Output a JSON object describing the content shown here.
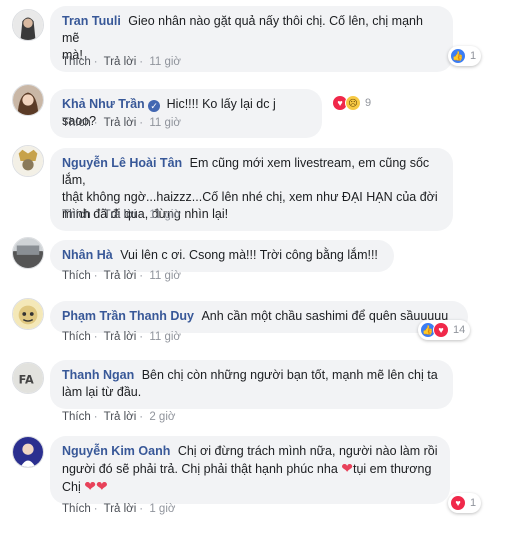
{
  "actions": {
    "like": "Thích",
    "reply": "Trả lời"
  },
  "comments": [
    {
      "author": "Tran Tuuli",
      "text_lines": [
        "Gieo nhân nào gặt quả nấy thôi chị. Cố lên, chị mạnh mẽ",
        "mà!"
      ],
      "time": "11 giờ",
      "reaction_count": "1",
      "reaction_types": [
        "like"
      ]
    },
    {
      "author": "Khả Như Trần",
      "verified": true,
      "text_lines": [
        "Hic!!!! Ko lấy lại dc j saoo?"
      ],
      "time": "11 giờ",
      "reaction_count": "9",
      "reaction_types": [
        "love",
        "sad"
      ]
    },
    {
      "author": "Nguyễn Lê Hoài Tân",
      "text_lines": [
        "Em cũng mới xem livestream, em cũng sốc lắm,",
        "thật không ngờ...haizzz...Cố lên nhé chị, xem như ĐẠI HẠN của đời",
        "mình đã đi qua, đừng nhìn lại!"
      ],
      "time": "11 giờ"
    },
    {
      "author": "Nhân Hà",
      "text_lines": [
        "Vui lên c ơi. Csong mà!!! Trời công bằng lắm!!!"
      ],
      "time": "11 giờ"
    },
    {
      "author": "Phạm Trần Thanh Duy",
      "text_lines": [
        "Anh cần một chầu sashimi để quên sầuuuuu"
      ],
      "time": "11 giờ",
      "reaction_count": "14",
      "reaction_types": [
        "like",
        "love"
      ]
    },
    {
      "author": "Thanh Ngan",
      "text_lines": [
        "Bên chị còn những người bạn tốt, mạnh mẽ lên chị ta",
        "làm lại từ đầu."
      ],
      "time": "2 giờ"
    },
    {
      "author": "Nguyễn Kim Oanh",
      "text_lines": [
        "Chị ơi đừng trách mình nữa, người nào làm rồi",
        "người đó sẽ phải trả. Chị phải thật hạnh phúc nha",
        "tụi em thương",
        "Chị"
      ],
      "time": "1 giờ",
      "reaction_count": "1",
      "reaction_types": [
        "love"
      ]
    }
  ],
  "icon_colors": {
    "link": "#385898",
    "like": "#3b7df4",
    "love": "#f0284a",
    "sad": "#f7c944",
    "bubble": "#f2f3f5"
  }
}
